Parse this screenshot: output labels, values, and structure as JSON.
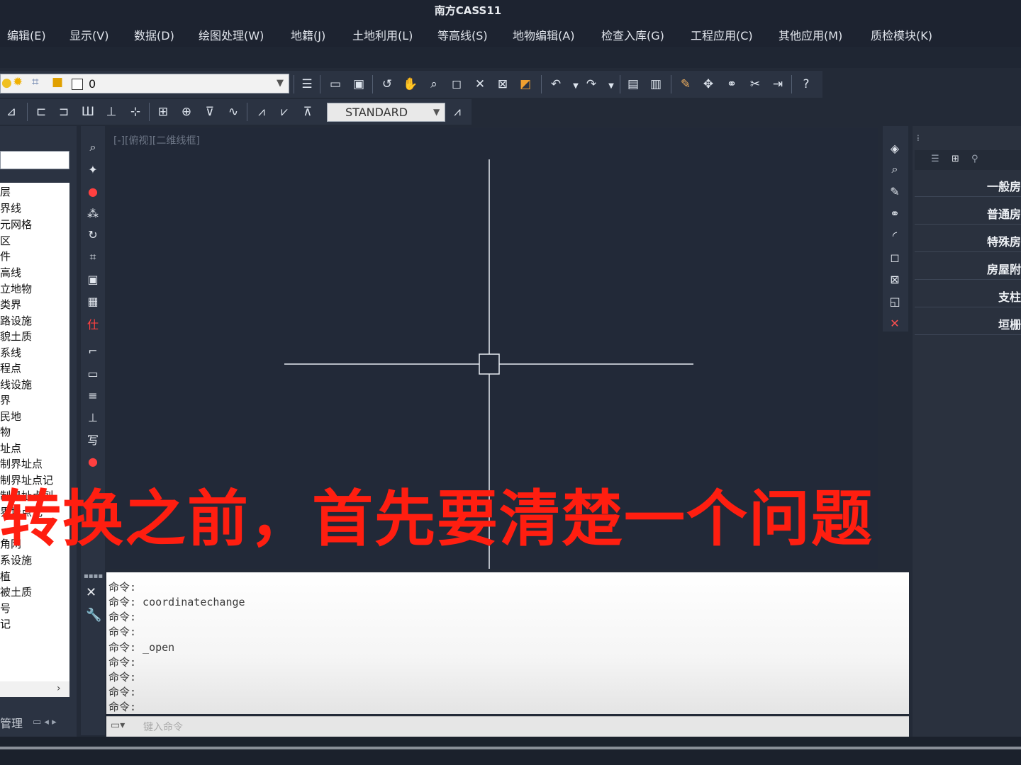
{
  "window": {
    "title": "南方CASS11"
  },
  "menu": [
    "编辑(E)",
    "显示(V)",
    "数据(D)",
    "绘图处理(W)",
    "地籍(J)",
    "土地利用(L)",
    "等高线(S)",
    "地物编辑(A)",
    "检查入库(G)",
    "工程应用(C)",
    "其他应用(M)",
    "质检模块(K)"
  ],
  "toolbar": {
    "layer_value": "0",
    "text_style": "STANDARD"
  },
  "viewport": {
    "label": "[-][俯视][二维线框]"
  },
  "left_panel": {
    "items": [
      "层",
      "界线",
      "元网格",
      "区",
      "件",
      "高线",
      "立地物",
      "类界",
      "路设施",
      "貌土质",
      "系线",
      "程点",
      "线设施",
      "界",
      "民地",
      "物",
      "址点",
      "制界址点",
      "制界址点记",
      "制界址点列",
      "界址点记",
      "角网",
      "系设施",
      "植",
      "被土质",
      "号",
      "记"
    ],
    "bottom_label": "管理"
  },
  "right_panel": {
    "items": [
      "一般房",
      "普通房",
      "特殊房",
      "房屋附",
      "支柱",
      "垣栅"
    ]
  },
  "command": {
    "prompt": "命令:",
    "lines": [
      "命令:",
      "命令: coordinatechange",
      "命令:",
      "命令:",
      "命令: _open",
      "命令:",
      "命令:",
      "命令:",
      "命令:"
    ],
    "placeholder": "键入命令"
  },
  "caption": "转换之前，首先要清楚一个问题",
  "colors": {
    "caption": "#ff1e10",
    "background": "#222938",
    "panel": "#2b3342"
  }
}
